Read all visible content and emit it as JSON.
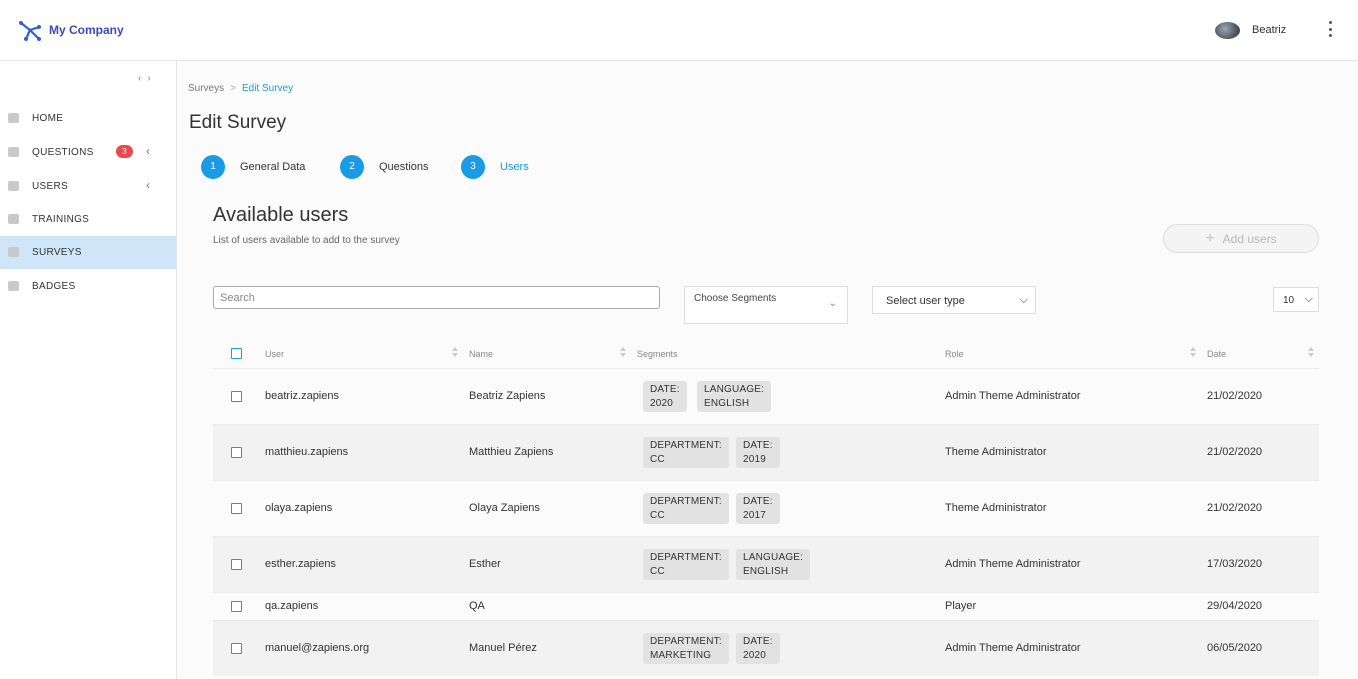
{
  "header": {
    "brand": "My Company",
    "username": "Beatriz"
  },
  "sidebar": {
    "items": [
      {
        "name": "home",
        "label": "HOME"
      },
      {
        "name": "questions",
        "label": "QUESTIONS",
        "badge": "3"
      },
      {
        "name": "users",
        "label": "USERS"
      },
      {
        "name": "trainings",
        "label": "TRAININGS"
      },
      {
        "name": "surveys",
        "label": "SURVEYS",
        "active": true
      },
      {
        "name": "badges",
        "label": "BADGES"
      }
    ]
  },
  "breadcrumb": {
    "parent": "Surveys",
    "separator": ">",
    "current": "Edit Survey"
  },
  "page_title": "Edit Survey",
  "steps": [
    {
      "num": "1",
      "label": "General Data"
    },
    {
      "num": "2",
      "label": "Questions"
    },
    {
      "num": "3",
      "label": "Users"
    }
  ],
  "section": {
    "title": "Available users",
    "subtitle": "List of users available to add to the survey",
    "add_button": "Add users"
  },
  "filters": {
    "search_placeholder": "Search",
    "segments_label": "Choose Segments",
    "user_type_label": "Select user type",
    "page_size": "10"
  },
  "table": {
    "columns": [
      "User",
      "Name",
      "Segments",
      "Role",
      "Date"
    ],
    "rows": [
      {
        "user": "beatriz.zapiens",
        "name": "Beatriz Zapiens",
        "tags": [
          [
            "DATE:",
            "2020"
          ],
          [
            "LANGUAGE:",
            "ENGLISH"
          ]
        ],
        "role": "Admin Theme Administrator",
        "date": "21/02/2020"
      },
      {
        "user": "matthieu.zapiens",
        "name": "Matthieu Zapiens",
        "tags": [
          [
            "DEPARTMENT:",
            "CC"
          ],
          [
            "DATE:",
            "2019"
          ]
        ],
        "role": "Theme Administrator",
        "date": "21/02/2020"
      },
      {
        "user": "olaya.zapiens",
        "name": "Olaya Zapiens",
        "tags": [
          [
            "DEPARTMENT:",
            "CC"
          ],
          [
            "DATE:",
            "2017"
          ]
        ],
        "role": "Theme Administrator",
        "date": "21/02/2020"
      },
      {
        "user": "esther.zapiens",
        "name": "Esther",
        "tags": [
          [
            "DEPARTMENT:",
            "CC"
          ],
          [
            "LANGUAGE:",
            "ENGLISH"
          ]
        ],
        "role": "Admin Theme Administrator",
        "date": "17/03/2020"
      },
      {
        "user": "qa.zapiens",
        "name": "QA",
        "tags": [],
        "role": "Player",
        "date": "29/04/2020"
      },
      {
        "user": "manuel@zapiens.org",
        "name": "Manuel Pérez",
        "tags": [
          [
            "DEPARTMENT:",
            "MARKETING"
          ],
          [
            "DATE:",
            "2020"
          ]
        ],
        "role": "Admin Theme Administrator",
        "date": "06/05/2020"
      }
    ]
  },
  "colors": {
    "accent": "#1a9be5",
    "brand": "#3a4ab8",
    "active_nav": "#cfe6f8",
    "badge": "#ea4a4f"
  }
}
